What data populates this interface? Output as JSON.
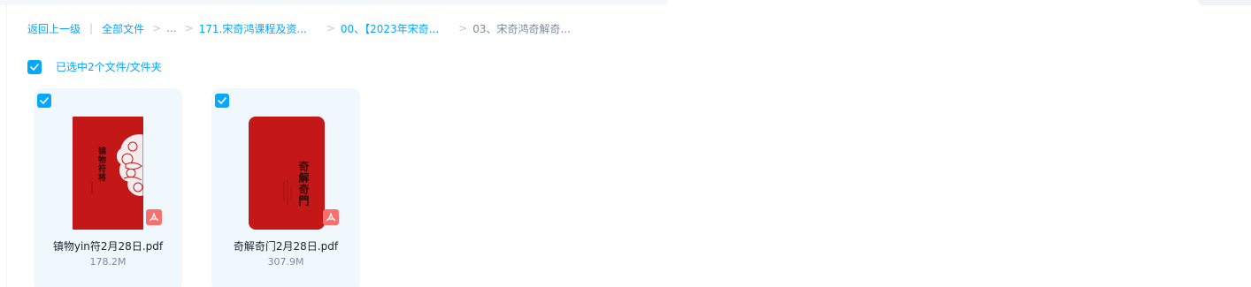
{
  "breadcrumb": {
    "back": "返回上一级",
    "divider": "|",
    "all_files": "全部文件",
    "ellipsis": "...",
    "folder1": "171.宋奇鸿课程及资...",
    "folder2": "00、【2023年宋奇...",
    "current": "03、宋奇鸿奇解奇..."
  },
  "selection": {
    "label": "已选中2个文件/文件夹"
  },
  "files": [
    {
      "name": "镇物yin符2月28日.pdf",
      "size": "178.2M",
      "cover_title": "镇物符将",
      "type_icon": "pdf-icon"
    },
    {
      "name": "奇解奇门2月28日.pdf",
      "size": "307.9M",
      "cover_title": "奇解奇門",
      "type_icon": "pdf-icon"
    }
  ],
  "colors": {
    "accent": "#06a7ff",
    "card_bg": "#f0f8fd",
    "cover_red": "#c41718",
    "pdf_badge": "#fb6e6e"
  }
}
